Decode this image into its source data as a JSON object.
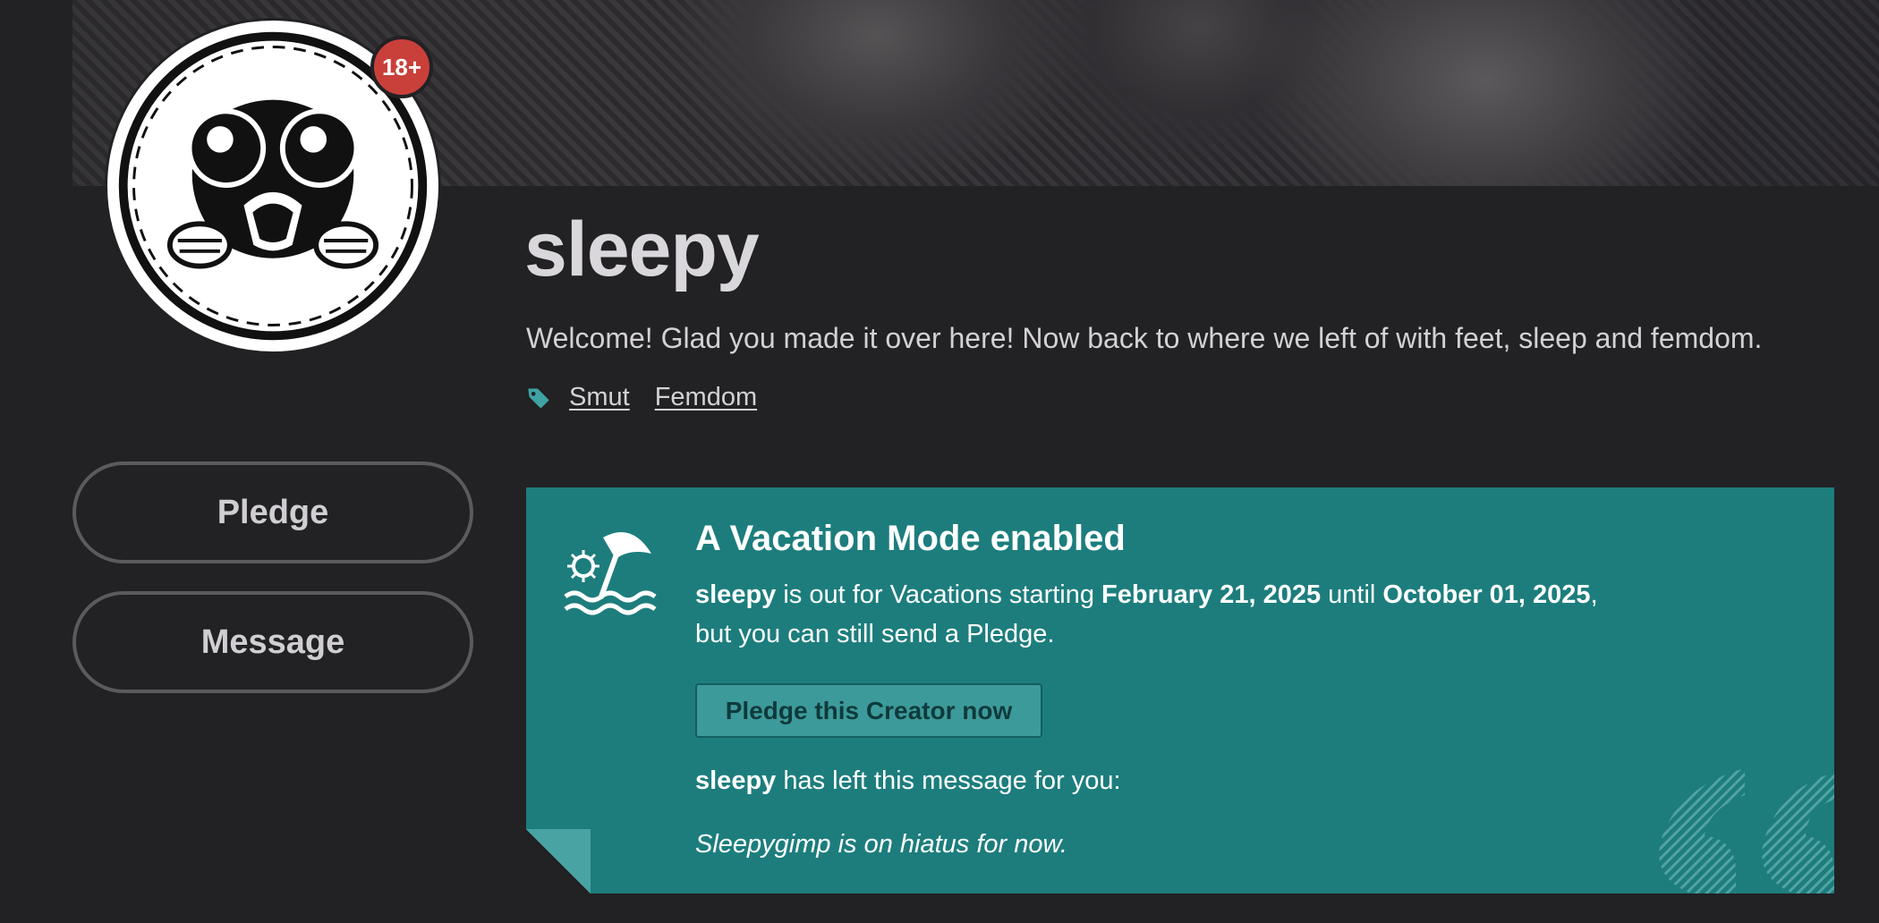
{
  "creator": {
    "name": "sleepy",
    "bio": "Welcome! Glad you made it over here! Now back to where we left of with feet, sleep and femdom.",
    "age_badge": "18+",
    "tags": [
      "Smut",
      "Femdom"
    ]
  },
  "sidebar": {
    "pledge_label": "Pledge",
    "message_label": "Message"
  },
  "vacation": {
    "title": "A Vacation Mode enabled",
    "creator_name": "sleepy",
    "text_1": " is out for Vacations starting ",
    "start_date": "February 21, 2025",
    "text_2": " until ",
    "end_date": "October 01, 2025",
    "text_3": ",",
    "line2": "but you can still send a Pledge.",
    "cta_label": "Pledge this Creator now",
    "message_intro_rest": " has left this message for you:",
    "message": "Sleepygimp is on hiatus for now."
  },
  "colors": {
    "page_bg": "#222124",
    "vacation_bg": "#1d7d7d",
    "badge_red": "#c9403b",
    "tag_icon_teal": "#3fa3a3"
  },
  "icons": {
    "tag": "tag-icon",
    "vacation": "beach-umbrella-icon",
    "quote": "quote-decoration-icon"
  }
}
